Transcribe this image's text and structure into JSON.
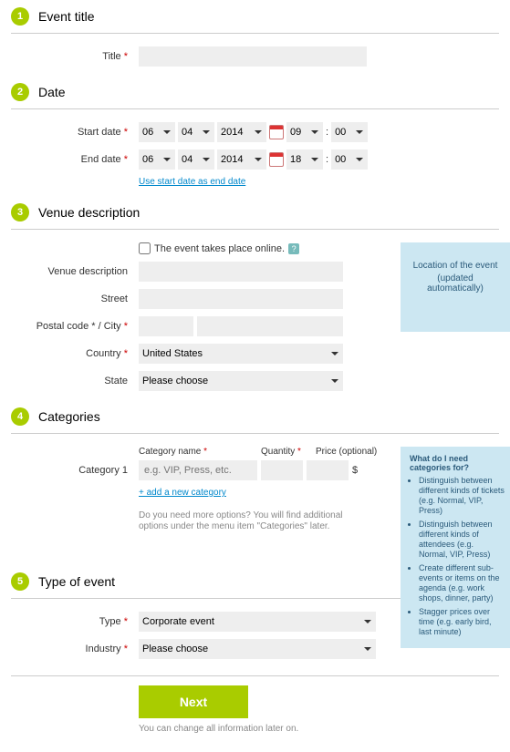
{
  "sections": {
    "title": {
      "num": "1",
      "heading": "Event title",
      "label": "Title"
    },
    "date": {
      "num": "2",
      "heading": "Date",
      "startLabel": "Start date",
      "endLabel": "End date",
      "startDay": "06",
      "startMonth": "04",
      "startYear": "2014",
      "startHour": "09",
      "startMin": "00",
      "endDay": "06",
      "endMonth": "04",
      "endYear": "2014",
      "endHour": "18",
      "endMin": "00",
      "useStartLink": "Use start date as end date"
    },
    "venue": {
      "num": "3",
      "heading": "Venue description",
      "onlineLabel": "The event takes place online.",
      "descLabel": "Venue description",
      "streetLabel": "Street",
      "postalCityLabel": "Postal code * / City",
      "countryLabel": "Country",
      "countryValue": "United States",
      "stateLabel": "State",
      "stateValue": "Please choose",
      "infoTitle": "Location of the event",
      "infoSub": "(updated automatically)"
    },
    "categories": {
      "num": "4",
      "heading": "Categories",
      "nameHead": "Category name",
      "qtyHead": "Quantity",
      "priceHead": "Price (optional)",
      "rowLabel": "Category 1",
      "placeholder": "e.g. VIP, Press, etc.",
      "currency": "$",
      "addLink": "+ add a new category",
      "helpText": "Do you need more options? You will find additional options under the menu item \"Categories\" later.",
      "infoTitle": "What do I need categories for?",
      "infoItems": [
        "Distinguish between different kinds of tickets (e.g. Normal, VIP, Press)",
        "Distinguish between different kinds of attendees (e.g. Normal, VIP, Press)",
        "Create different sub-events or items on the agenda (e.g. work shops, dinner, party)",
        "Stagger prices over time (e.g. early bird, last minute)"
      ]
    },
    "type": {
      "num": "5",
      "heading": "Type of event",
      "typeLabel": "Type",
      "typeValue": "Corporate event",
      "industryLabel": "Industry",
      "industryValue": "Please choose"
    },
    "footer": {
      "nextLabel": "Next",
      "hint": "You can change all information later on."
    }
  }
}
